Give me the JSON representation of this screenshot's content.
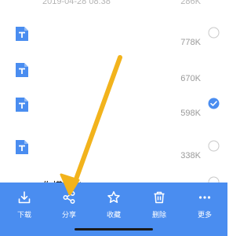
{
  "colors": {
    "toolbar_bg": "#4a8df0",
    "file_icon": "#4a8df0",
    "check_selected": "#4a8df0",
    "arrow": "#f2b31c"
  },
  "top_partial": {
    "date": "2019-04-28 08:38",
    "size": "286K"
  },
  "files": [
    {
      "name": "",
      "size": "778K",
      "icon": "txt-file-icon",
      "selected": false
    },
    {
      "name": "",
      "size": "670K",
      "icon": "txt-file-icon",
      "selected": false
    },
    {
      "name": "",
      "size": "598K",
      "icon": "txt-file-icon",
      "selected": true
    },
    {
      "name": "",
      "size": "338K",
      "icon": "txt-file-icon",
      "selected": false
    },
    {
      "name": "你摸我 d.txt",
      "size": "",
      "icon": "txt-file-icon",
      "selected": false
    }
  ],
  "toolbar": {
    "download_label": "下载",
    "share_label": "分享",
    "favorite_label": "收藏",
    "delete_label": "删除",
    "more_label": "更多"
  }
}
